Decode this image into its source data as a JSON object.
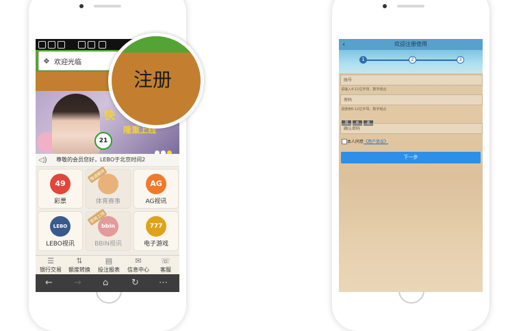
{
  "left_phone": {
    "address_bar": {
      "text": "欢迎光临"
    },
    "magnifier": {
      "text": "注册"
    },
    "banner": {
      "headline_part1": "快",
      "headline_part2": "隆重上线",
      "ball_number": "21"
    },
    "notice": {
      "text": "尊敬的会员您好，LEBO于北京时间2"
    },
    "tiles": [
      {
        "label": "彩票",
        "icon": "lottery-balls-icon",
        "icon_text": "49",
        "color": "#e2453a",
        "disabled": false,
        "badge": ""
      },
      {
        "label": "体育赛事",
        "icon": "sports-ball-icon",
        "icon_text": "",
        "color": "#e8b27a",
        "disabled": true,
        "badge": "敬请期待"
      },
      {
        "label": "AG视讯",
        "icon": "ag-logo-icon",
        "icon_text": "AG",
        "color": "#f07a2a",
        "disabled": false,
        "badge": ""
      },
      {
        "label": "LEBO视讯",
        "icon": "lebo-logo-icon",
        "icon_text": "LEBO",
        "color": "#3a5a8c",
        "disabled": false,
        "badge": ""
      },
      {
        "label": "BBIN视讯",
        "icon": "bbin-logo-icon",
        "icon_text": "bbin",
        "color": "#e39a9a",
        "disabled": true,
        "badge": "即将上线"
      },
      {
        "label": "电子游戏",
        "icon": "slot-777-icon",
        "icon_text": "777",
        "color": "#e0a21a",
        "disabled": false,
        "badge": ""
      }
    ],
    "bottom_nav": [
      {
        "label": "银行交易",
        "icon": "coins-icon",
        "glyph": "☰"
      },
      {
        "label": "额度转换",
        "icon": "transfer-icon",
        "glyph": "⇅"
      },
      {
        "label": "投注报表",
        "icon": "report-icon",
        "glyph": "▤"
      },
      {
        "label": "信息中心",
        "icon": "mail-icon",
        "glyph": "✉"
      },
      {
        "label": "客服",
        "icon": "headset-icon",
        "glyph": "☏"
      }
    ],
    "system_bar": [
      "←",
      "→",
      "⌂",
      "↻",
      "⋯"
    ]
  },
  "right_phone": {
    "header": {
      "back": "‹",
      "title": "欢迎注册使用"
    },
    "steps": [
      "1",
      "2",
      "3"
    ],
    "fields": [
      {
        "placeholder": "账号",
        "hint": "请输入4-11位字母、数字组合"
      },
      {
        "placeholder": "密码",
        "hint": "请使用6-12位字母、数字组合"
      },
      {
        "placeholder": "确认密码",
        "hint": ""
      }
    ],
    "strength": [
      "弱",
      "中",
      "强"
    ],
    "agree": {
      "prefix": "本人同意",
      "link": "《用户协议》"
    },
    "next_button": "下一步"
  },
  "colors": {
    "green": "#54a435",
    "orange": "#c37f2f",
    "blue_button": "#2d8fe8",
    "header_blue": "#58a1cc"
  }
}
